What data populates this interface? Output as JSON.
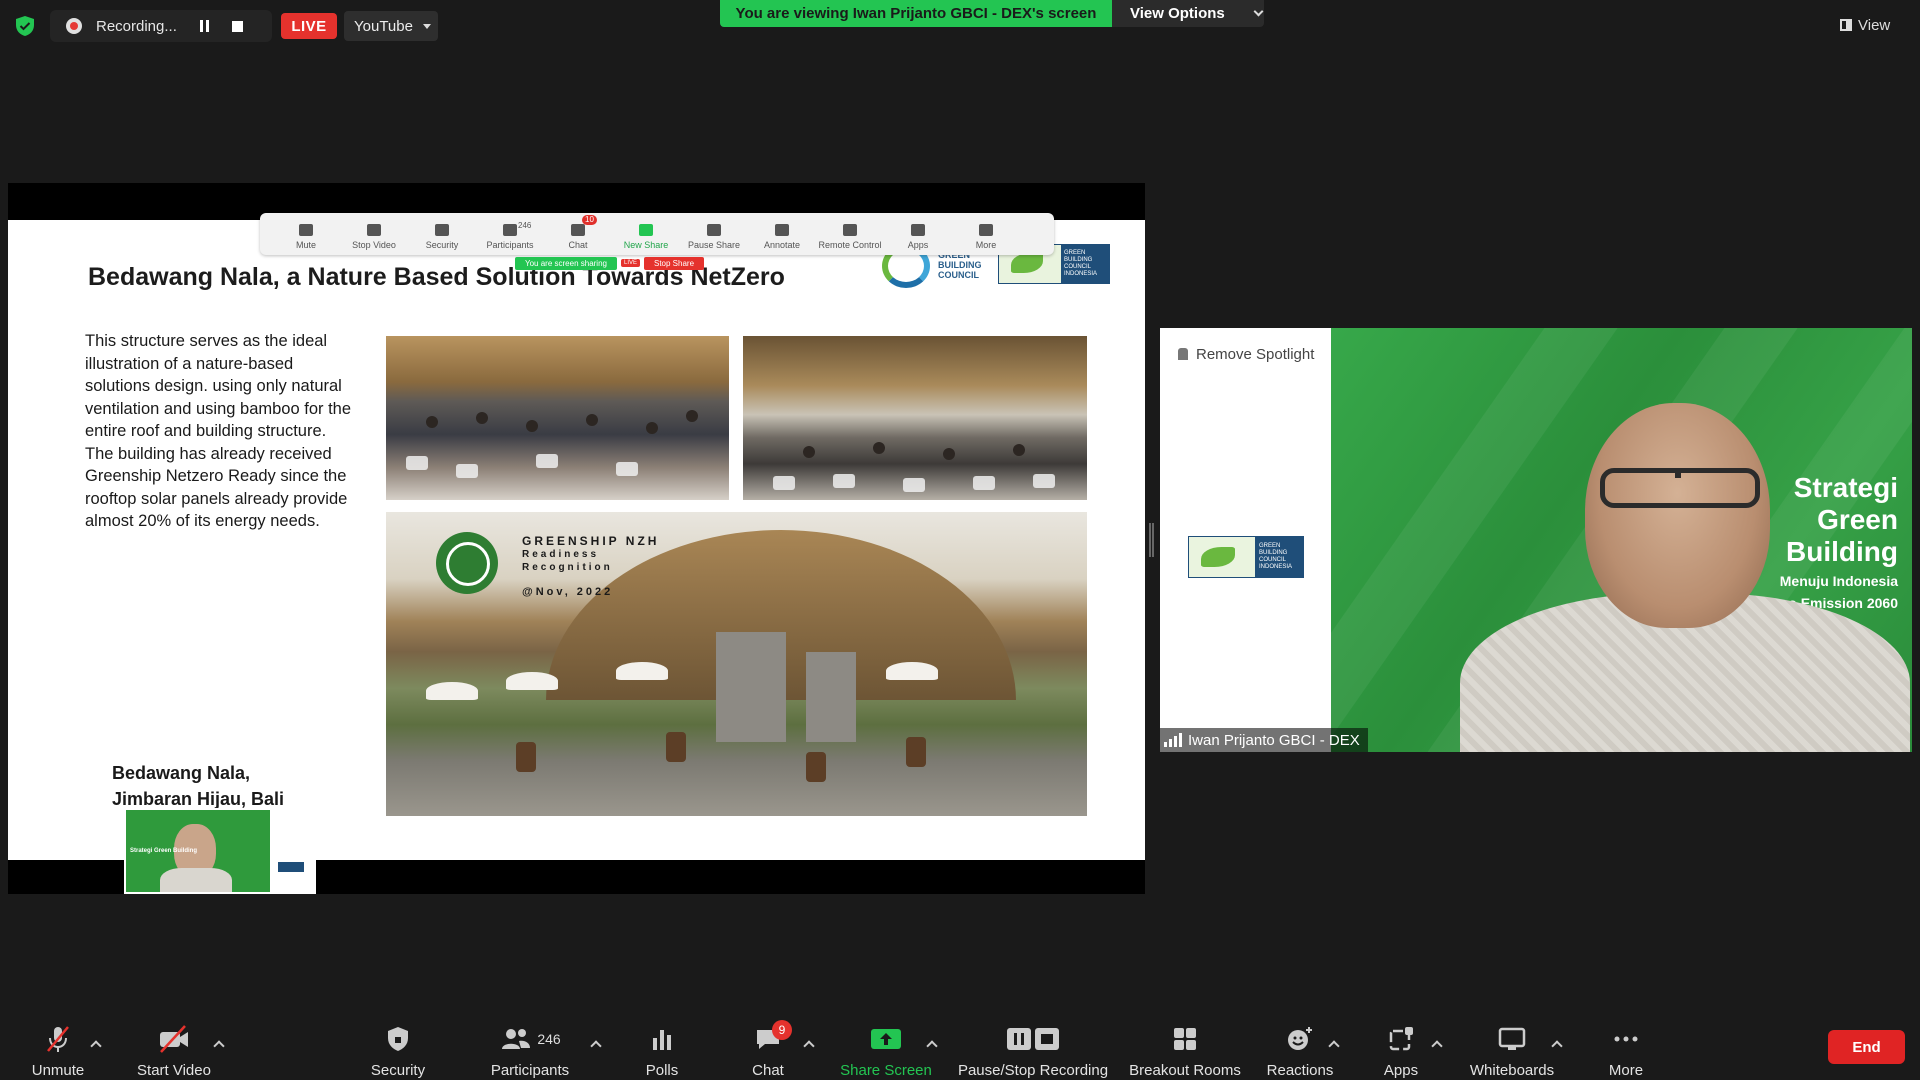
{
  "topbar": {
    "recording_label": "Recording...",
    "live_label": "LIVE",
    "stream_target": "YouTube",
    "viewing_banner": "You are viewing Iwan Prijanto GBCI - DEX's screen",
    "view_options_label": "View Options",
    "view_label": "View"
  },
  "slide": {
    "title": "Bedawang Nala, a Nature Based Solution Towards NetZero",
    "body": "This structure serves as the ideal illustration of a nature-based solutions design. using only natural ventilation and using bamboo for the entire roof and building structure. The building has already received Greenship Netzero Ready since the rooftop solar panels already provide almost 20% of its energy needs.",
    "caption_line1": "Bedawang Nala,",
    "caption_line2": "Jimbaran Hijau, Bali",
    "logo_gbc_text_1": "GREEN",
    "logo_gbc_text_2": "BUILDING",
    "logo_gbc_text_3": "COUNCIL",
    "logo_gbci_text": "GREEN BUILDING COUNCIL INDONESIA",
    "greenship_title": "GREENSHIP NZH",
    "greenship_sub1": "Readiness",
    "greenship_sub2": "Recognition",
    "greenship_date": "@Nov, 2022"
  },
  "mini_toolbar": {
    "items": [
      {
        "label": "Mute"
      },
      {
        "label": "Stop Video"
      },
      {
        "label": "Security"
      },
      {
        "label": "Participants",
        "count": "246"
      },
      {
        "label": "Chat",
        "badge": "10"
      },
      {
        "label": "New Share"
      },
      {
        "label": "Pause Share"
      },
      {
        "label": "Annotate"
      },
      {
        "label": "Remote Control"
      },
      {
        "label": "Apps"
      },
      {
        "label": "More"
      }
    ],
    "sharing_text": "You are screen sharing",
    "live_text": "LIVE",
    "stop_share": "Stop Share"
  },
  "thumbnail": {
    "text": "Strategi Green Building"
  },
  "speaker": {
    "remove_spotlight": "Remove Spotlight",
    "name": "Iwan Prijanto GBCI - DEX",
    "bg_title_1": "Strategi",
    "bg_title_2": "Green",
    "bg_title_3": "Building",
    "bg_sub_1": "Menuju Indonesia",
    "bg_sub_2": "et Zero Emission 2060",
    "logo_text": "GREEN BUILDING COUNCIL INDONESIA"
  },
  "toolbar": {
    "unmute": "Unmute",
    "start_video": "Start Video",
    "security": "Security",
    "participants": "Participants",
    "participants_count": "246",
    "polls": "Polls",
    "chat": "Chat",
    "chat_badge": "9",
    "share_screen": "Share Screen",
    "pause_stop_recording": "Pause/Stop Recording",
    "breakout_rooms": "Breakout Rooms",
    "reactions": "Reactions",
    "apps": "Apps",
    "whiteboards": "Whiteboards",
    "more": "More",
    "end": "End"
  },
  "colors": {
    "zoom_green": "#23c552",
    "live_red": "#e5322d",
    "end_red": "#e02424",
    "background": "#1a1a1a"
  }
}
